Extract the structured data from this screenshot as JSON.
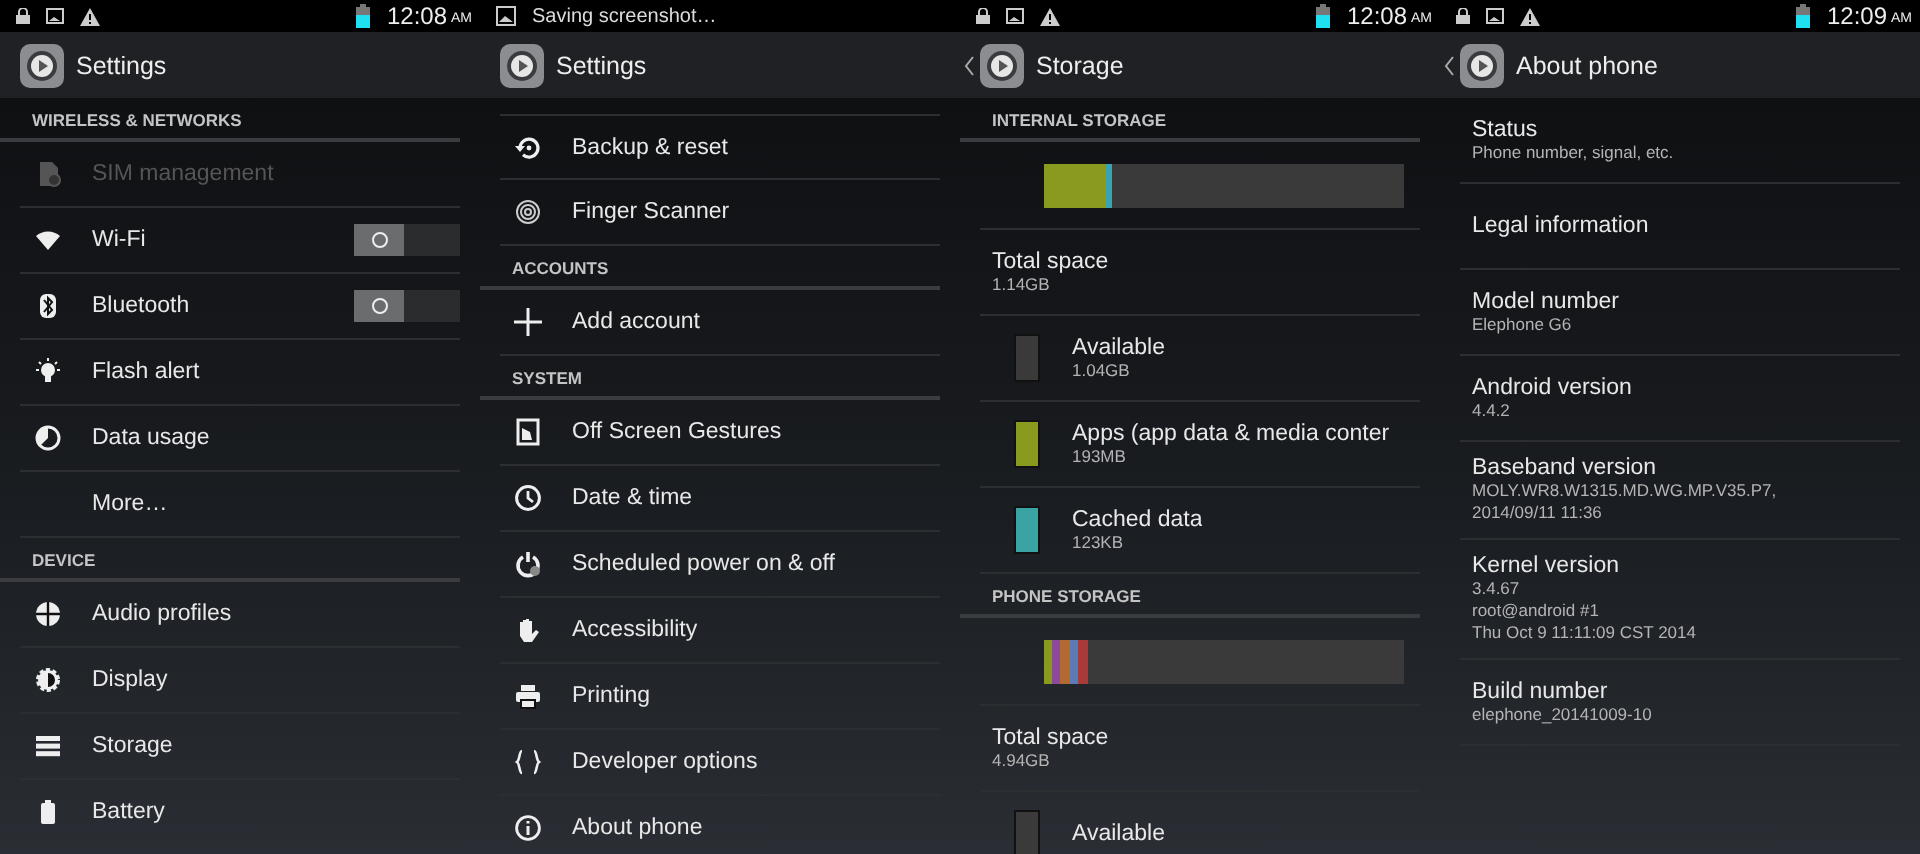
{
  "screens": [
    {
      "status_bar": {
        "time": "12:08",
        "meridiem": "AM"
      },
      "title": "Settings",
      "back": false,
      "rows": [
        {
          "kind": "header",
          "label": "WIRELESS & NETWORKS"
        },
        {
          "kind": "item",
          "label": "SIM management",
          "disabled": true
        },
        {
          "kind": "toggle",
          "label": "Wi-Fi",
          "disabled": false,
          "on": false
        },
        {
          "kind": "toggle",
          "label": "Bluetooth",
          "disabled": false,
          "on": false
        },
        {
          "kind": "item",
          "label": "Flash alert",
          "disabled": false
        },
        {
          "kind": "item",
          "label": "Data usage",
          "disabled": false
        },
        {
          "kind": "item",
          "label": "More…",
          "disabled": false
        },
        {
          "kind": "header",
          "label": "DEVICE"
        },
        {
          "kind": "item",
          "label": "Audio profiles",
          "disabled": false
        },
        {
          "kind": "item",
          "label": "Display",
          "disabled": false
        },
        {
          "kind": "item",
          "label": "Storage",
          "disabled": false
        },
        {
          "kind": "item",
          "label": "Battery",
          "disabled": false
        }
      ]
    },
    {
      "status_bar": {
        "notification": "Saving screenshot…"
      },
      "title": "Settings",
      "back": false,
      "rows": [
        {
          "kind": "item",
          "label": "Backup & reset",
          "disabled": false
        },
        {
          "kind": "item",
          "label": "Finger Scanner",
          "disabled": false
        },
        {
          "kind": "header",
          "label": "ACCOUNTS"
        },
        {
          "kind": "item",
          "label": "Add account",
          "disabled": false
        },
        {
          "kind": "header",
          "label": "SYSTEM"
        },
        {
          "kind": "item",
          "label": "Off Screen Gestures",
          "disabled": false
        },
        {
          "kind": "item",
          "label": "Date & time",
          "disabled": false
        },
        {
          "kind": "item",
          "label": "Scheduled power on & off",
          "disabled": false
        },
        {
          "kind": "item",
          "label": "Accessibility",
          "disabled": false
        },
        {
          "kind": "item",
          "label": "Printing",
          "disabled": false
        },
        {
          "kind": "item",
          "label": "Developer options",
          "disabled": false
        },
        {
          "kind": "item",
          "label": "About phone",
          "disabled": false
        }
      ]
    },
    {
      "status_bar": {
        "time": "12:08",
        "meridiem": "AM"
      },
      "title": "Storage",
      "back": true,
      "rows": [
        {
          "kind": "header",
          "label": "INTERNAL STORAGE"
        },
        {
          "kind": "bar",
          "segments": [
            {
              "color": "#8a9a1e"
            },
            {
              "color": "#3aa3b3"
            }
          ]
        },
        {
          "kind": "info",
          "title": "Total space",
          "lines": [
            "1.14GB"
          ]
        },
        {
          "kind": "usage",
          "title": "Available",
          "value": "1.04GB",
          "color": "#3a3a3a"
        },
        {
          "kind": "usage",
          "title": "Apps (app data & media conter",
          "value": "193MB",
          "color": "#8a9a1e"
        },
        {
          "kind": "usage",
          "title": "Cached data",
          "value": "123KB",
          "color": "#3aa3a3"
        },
        {
          "kind": "header",
          "label": "PHONE STORAGE"
        },
        {
          "kind": "bar",
          "segments": [
            {
              "color": "#8a9a1e"
            },
            {
              "color": "#8e4a9a"
            },
            {
              "color": "#b06a32"
            },
            {
              "color": "#5a7ab8"
            },
            {
              "color": "#a83a3a"
            }
          ]
        },
        {
          "kind": "info",
          "title": "Total space",
          "lines": [
            "4.94GB"
          ]
        },
        {
          "kind": "usage",
          "title": "Available",
          "value": "",
          "color": "#3a3a3a"
        }
      ]
    },
    {
      "status_bar": {
        "time": "12:09",
        "meridiem": "AM"
      },
      "title": "About phone",
      "back": true,
      "rows": [
        {
          "kind": "info",
          "title": "Status",
          "lines": [
            "Phone number, signal, etc."
          ]
        },
        {
          "kind": "info",
          "title": "Legal information",
          "lines": []
        },
        {
          "kind": "info",
          "title": "Model number",
          "lines": [
            "Elephone G6"
          ]
        },
        {
          "kind": "info",
          "title": "Android version",
          "lines": [
            "4.4.2"
          ]
        },
        {
          "kind": "info",
          "title": "Baseband version",
          "lines": [
            "MOLY.WR8.W1315.MD.WG.MP.V35.P7,",
            "2014/09/11 11:36"
          ]
        },
        {
          "kind": "info",
          "title": "Kernel version",
          "lines": [
            "3.4.67",
            "root@android #1",
            "Thu Oct 9 11:11:09 CST 2014"
          ]
        },
        {
          "kind": "info",
          "title": "Build number",
          "lines": [
            "elephone_20141009-10"
          ]
        }
      ]
    }
  ]
}
